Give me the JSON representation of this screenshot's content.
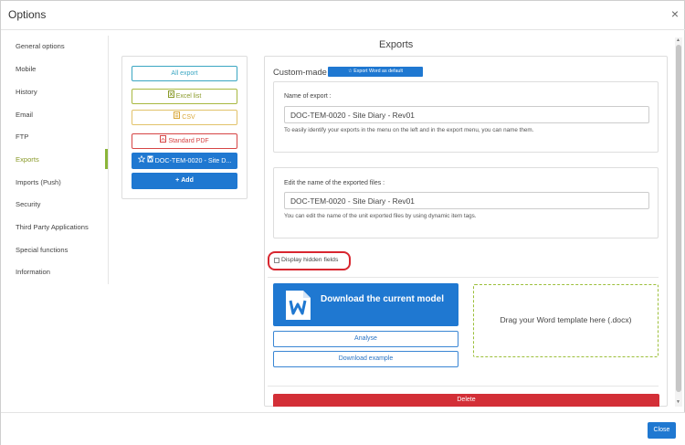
{
  "dialog": {
    "title": "Options",
    "close_glyph": "×"
  },
  "sidebar": {
    "items": [
      "General options",
      "Mobile",
      "History",
      "Email",
      "FTP",
      "Exports",
      "Imports (Push)",
      "Security",
      "Third Party Applications",
      "Special functions",
      "Information"
    ],
    "active": "Exports"
  },
  "exports": {
    "title": "Exports",
    "list": {
      "all_export": "All export",
      "excel": "Excel list",
      "csv": "CSV",
      "pdf": "Standard PDF",
      "word_template": "DOC-TEM-0020 - Site D...",
      "add": "Add"
    },
    "custom_word": {
      "title": "Custom-made Word",
      "default_badge": "Export Word as default",
      "name_label": "Name of export :",
      "name_value": "DOC-TEM-0020 - Site Diary - Rev01",
      "name_help": "To easily identify your exports in the menu on the left and in the export menu, you can name them.",
      "file_label": "Edit the name of the exported files :",
      "file_value": "DOC-TEM-0020 - Site Diary - Rev01",
      "file_help": "You can edit the name of the unit exported files by using dynamic item tags.",
      "hidden_fields": "Display hidden fields",
      "download_current": "Download the current model",
      "analyse": "Analyse",
      "download_example": "Download example",
      "dropzone": "Drag your Word template here (.docx)",
      "delete": "Delete"
    }
  },
  "footer": {
    "close": "Close"
  },
  "icons": {
    "excel": "excel-file-icon",
    "csv": "csv-file-icon",
    "pdf": "pdf-file-icon",
    "word": "word-file-icon",
    "star": "star-icon",
    "plus": "plus-icon"
  },
  "colors": {
    "primary": "#1f78d1",
    "danger": "#d32f37",
    "excel": "#8a9a2a",
    "csv": "#d9a83a",
    "pdf": "#d64545",
    "all_export": "#3aa6c2",
    "highlight": "#d8262f"
  }
}
